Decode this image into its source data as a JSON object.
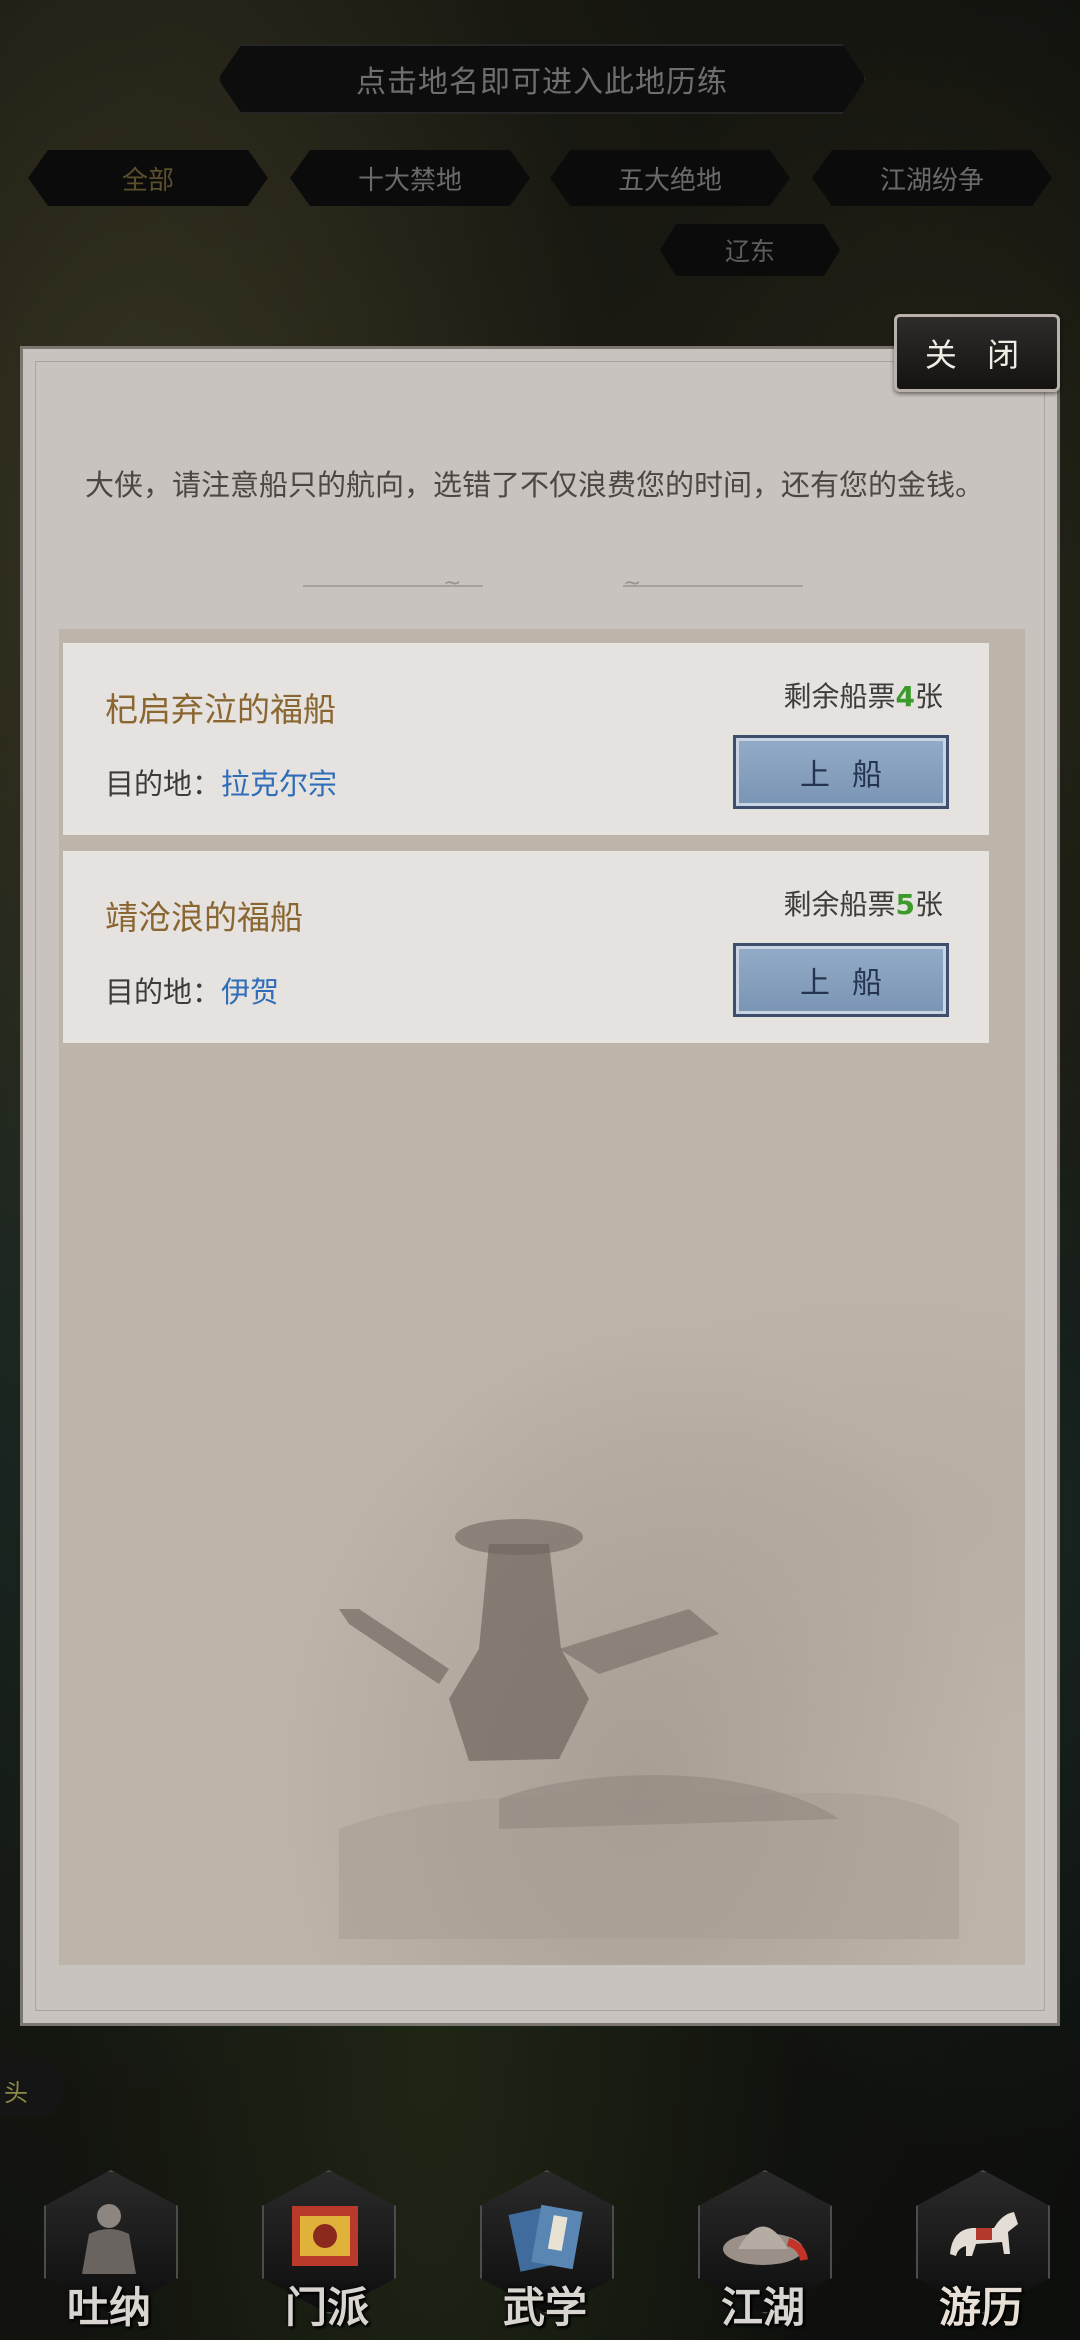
{
  "header": {
    "hint": "点击地名即可进入此地历练",
    "tabs": [
      {
        "label": "全部",
        "active": true
      },
      {
        "label": "十大禁地",
        "active": false
      },
      {
        "label": "五大绝地",
        "active": false
      },
      {
        "label": "江湖纷争",
        "active": false
      }
    ],
    "sub_tab": "辽东"
  },
  "dialog": {
    "close_label": "关 闭",
    "notice": "大侠，请注意船只的航向，选错了不仅浪费您的时间，还有您的金钱。",
    "destination_label": "目的地：",
    "ships": [
      {
        "name": "杞启弃泣的福船",
        "destination": "拉克尔宗",
        "tickets_prefix": "剩余船票",
        "tickets": "4",
        "tickets_suffix": "张",
        "board_label": "上船"
      },
      {
        "name": "靖沧浪的福船",
        "destination": "伊贺",
        "tickets_prefix": "剩余船票",
        "tickets": "5",
        "tickets_suffix": "张",
        "board_label": "上船"
      }
    ]
  },
  "side_tab": "头",
  "nav": [
    {
      "label": "吐纳",
      "icon": "meditation-figure-icon"
    },
    {
      "label": "门派",
      "icon": "sect-banner-icon"
    },
    {
      "label": "武学",
      "icon": "martial-book-icon"
    },
    {
      "label": "江湖",
      "icon": "straw-hat-icon"
    },
    {
      "label": "游历",
      "icon": "horse-icon",
      "active": true
    }
  ],
  "colors": {
    "ship_name": "#8a6630",
    "destination": "#2f6db8",
    "ticket_count": "#3c9a2d",
    "board_button": "#7a94b4"
  }
}
